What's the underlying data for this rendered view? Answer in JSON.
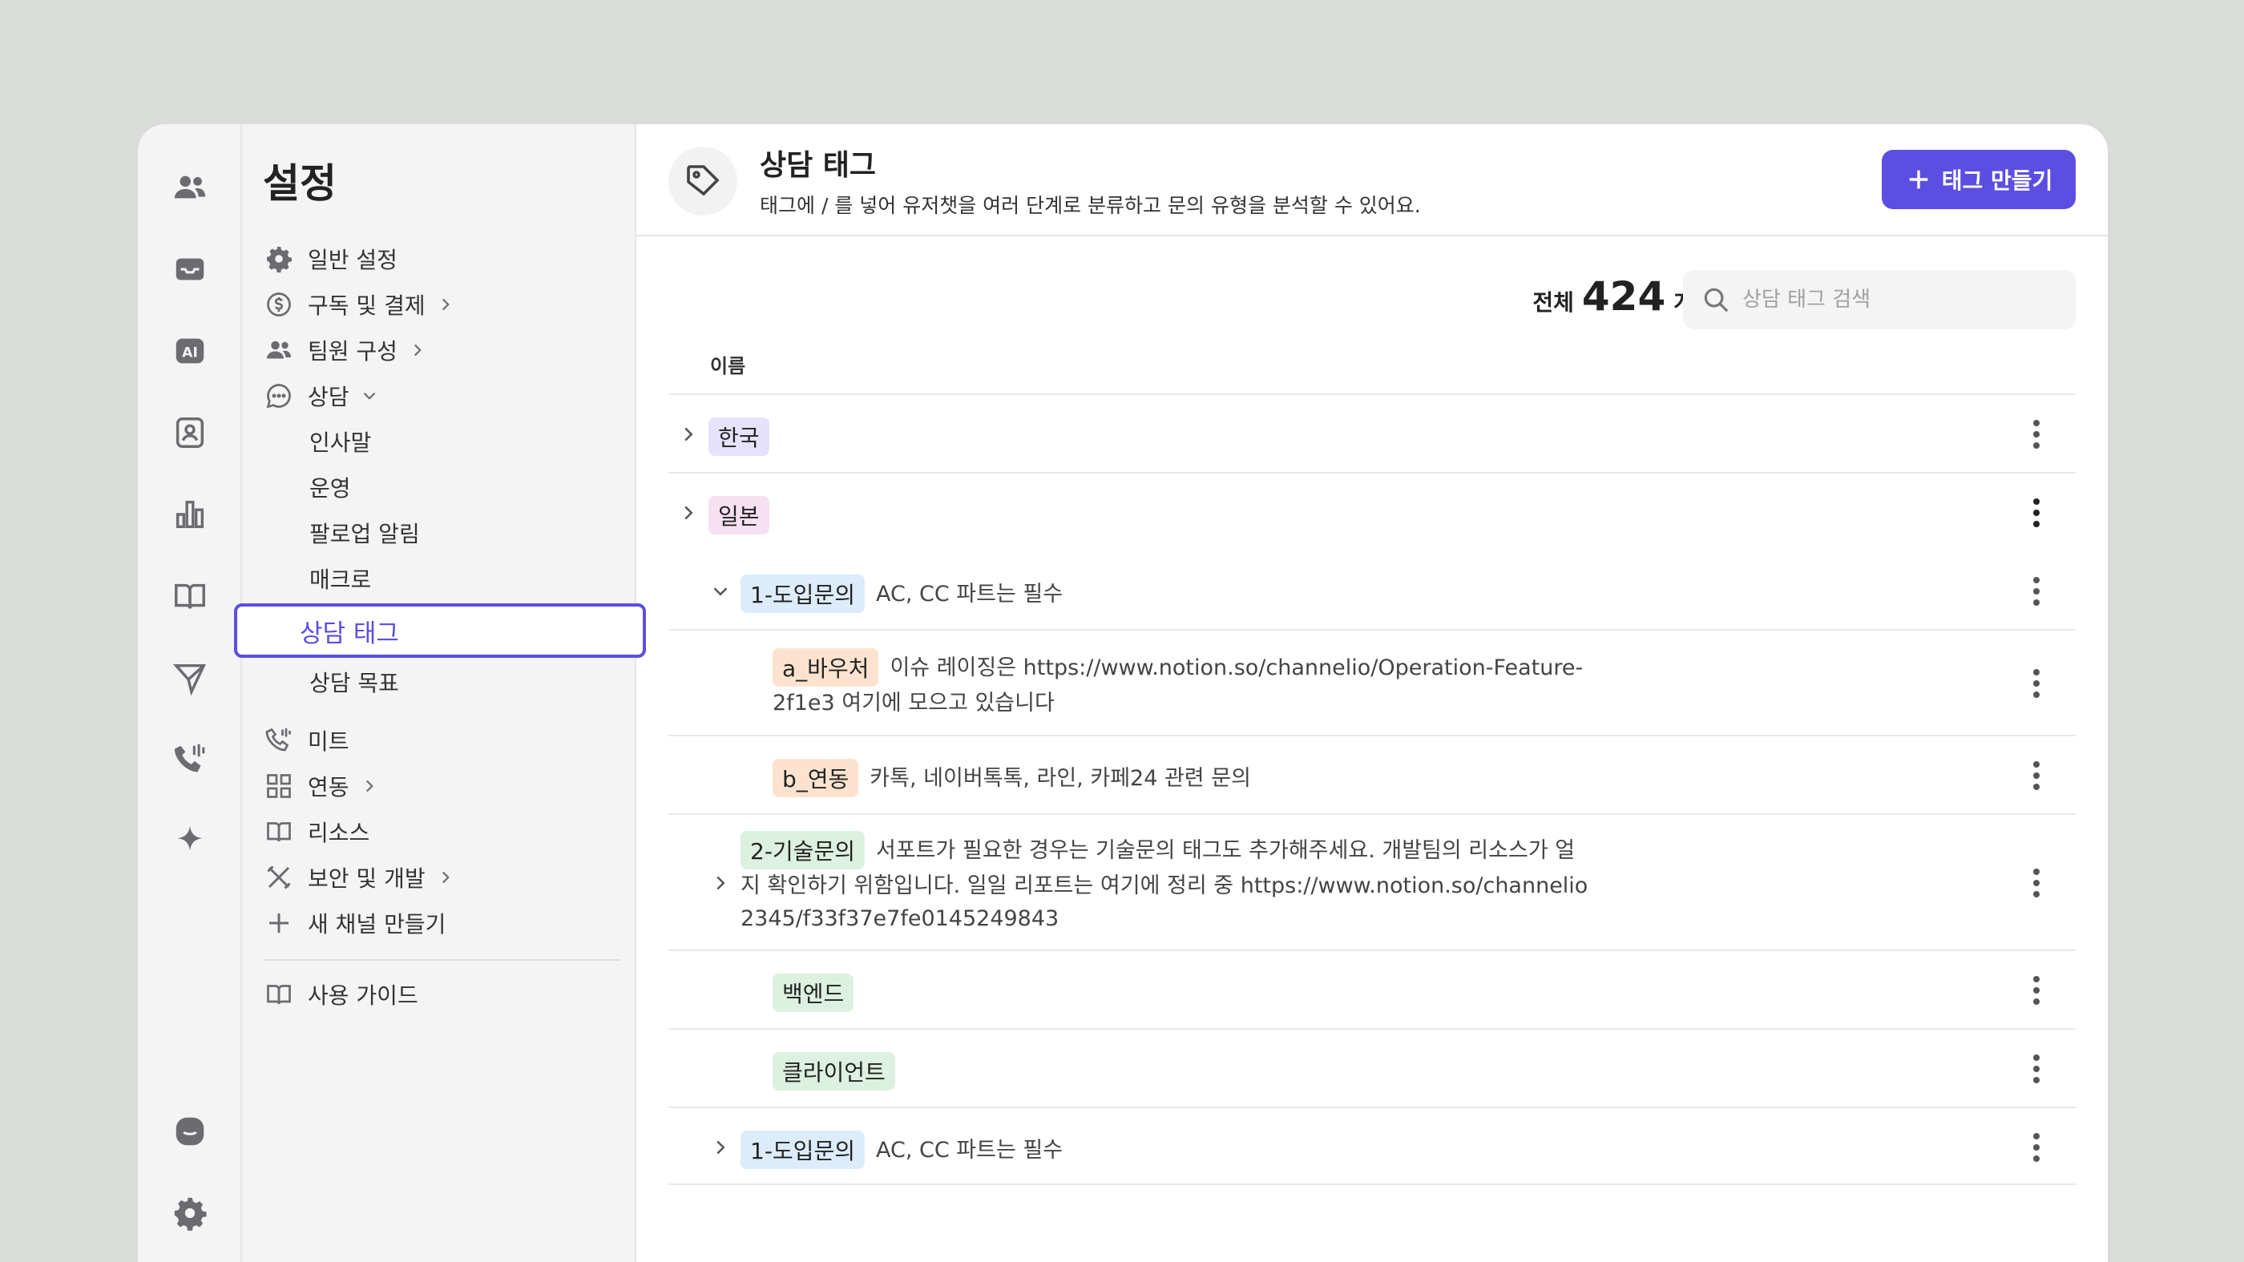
{
  "settings": {
    "title": "설정",
    "nav": {
      "general": "일반 설정",
      "billing": "구독 및 결제",
      "team": "팀원 구성",
      "consult": "상담",
      "greeting": "인사말",
      "operation": "운영",
      "followup": "팔로업 알림",
      "macro": "매크로",
      "tags": "상담 태그",
      "goals": "상담 목표",
      "meet": "미트",
      "integration": "연동",
      "resources": "리소스",
      "security": "보안 및 개발",
      "new_channel": "새 채널 만들기",
      "guide": "사용 가이드"
    }
  },
  "header": {
    "title": "상담 태그",
    "description": "태그에 / 를 넣어 유저챗을 여러 단계로 분류하고 문의 유형을 분석할 수 있어요.",
    "create_label": "태그 만들기"
  },
  "summary": {
    "total_label": "전체",
    "total_count": "424",
    "unit": "개",
    "search_placeholder": "상담 태그 검색"
  },
  "table": {
    "column_name": "이름",
    "rows": [
      {
        "tag": "한국",
        "desc": ""
      },
      {
        "tag": "일본",
        "desc": ""
      },
      {
        "tag": "1-도입문의",
        "desc": "AC, CC 파트는 필수"
      },
      {
        "tag": "a_바우처",
        "desc_line1": "이슈 레이징은 https://www.notion.so/channelio/Operation-Feature-",
        "desc_line2": "2f1e3 여기에 모으고 있습니다"
      },
      {
        "tag": "b_연동",
        "desc": "카톡, 네이버톡톡, 라인, 카페24 관련 문의"
      },
      {
        "tag": "2-기술문의",
        "desc_line1": "서포트가 필요한 경우는 기술문의 태그도 추가해주세요. 개발팀의 리소스가 얼",
        "desc_line2": "지 확인하기 위함입니다. 일일 리포트는 여기에 정리 중 https://www.notion.so/channelio",
        "desc_line3": "2345/f33f37e7fe0145249843"
      },
      {
        "tag": "백엔드",
        "desc": ""
      },
      {
        "tag": "클라이언트",
        "desc": ""
      },
      {
        "tag": "1-도입문의",
        "desc": "AC, CC 파트는 필수"
      }
    ]
  },
  "colors": {
    "accent": "#5b4ee0",
    "tag_purple": "#e6e2fb",
    "tag_pink": "#f7e0f1",
    "tag_blue": "#dcecfb",
    "tag_orange": "#fde3cf",
    "tag_green": "#dcf1df"
  }
}
